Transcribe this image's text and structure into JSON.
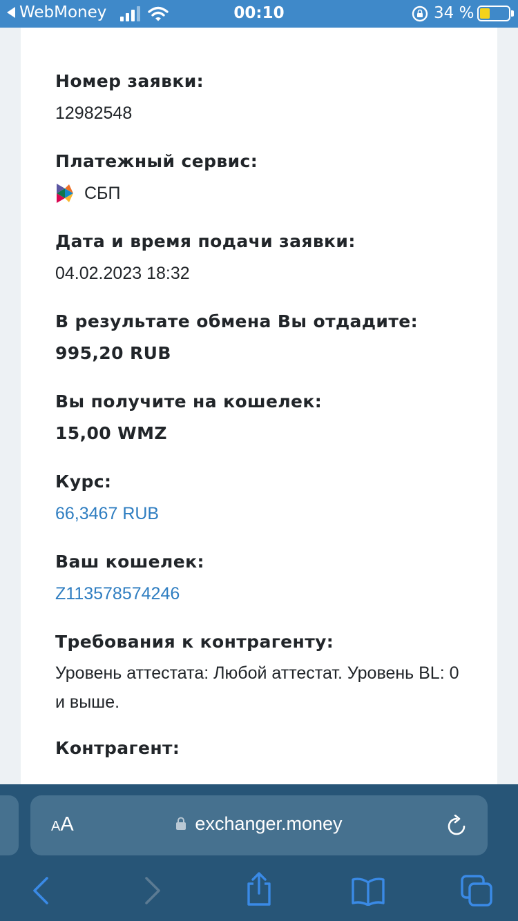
{
  "status_bar": {
    "back_app": "WebMoney",
    "time": "00:10",
    "battery_percent": "34 %",
    "battery_level": 0.34
  },
  "fields": [
    {
      "label": "Номер заявки:",
      "value": "12982548"
    },
    {
      "label": "Платежный сервис:",
      "value": "СБП",
      "icon": "sbp-logo-icon"
    },
    {
      "label": "Дата и время подачи заявки:",
      "value": "04.02.2023 18:32"
    },
    {
      "label": "В результате обмена Вы отдадите:",
      "value": "995,20 RUB"
    },
    {
      "label": "Вы получите на кошелек:",
      "value": "15,00 WMZ"
    },
    {
      "label": "Курс:",
      "value": "66,3467 RUB"
    },
    {
      "label": "Ваш кошелек:",
      "value": "Z113578574246"
    },
    {
      "label": "Требования к контрагенту:",
      "value": "Уровень аттестата: Любой аттестат. Уровень BL: 0 и выше."
    },
    {
      "label": "Контрагент:"
    }
  ],
  "browser": {
    "text_size_label_small": "A",
    "text_size_label_big": "A",
    "url": "exchanger.money"
  },
  "colors": {
    "status_bar": "#3f89c9",
    "link": "#2f7ec1",
    "toolbar": "#275577",
    "address_bar": "#46718f",
    "toolbar_icon": "#3a8ae6"
  }
}
